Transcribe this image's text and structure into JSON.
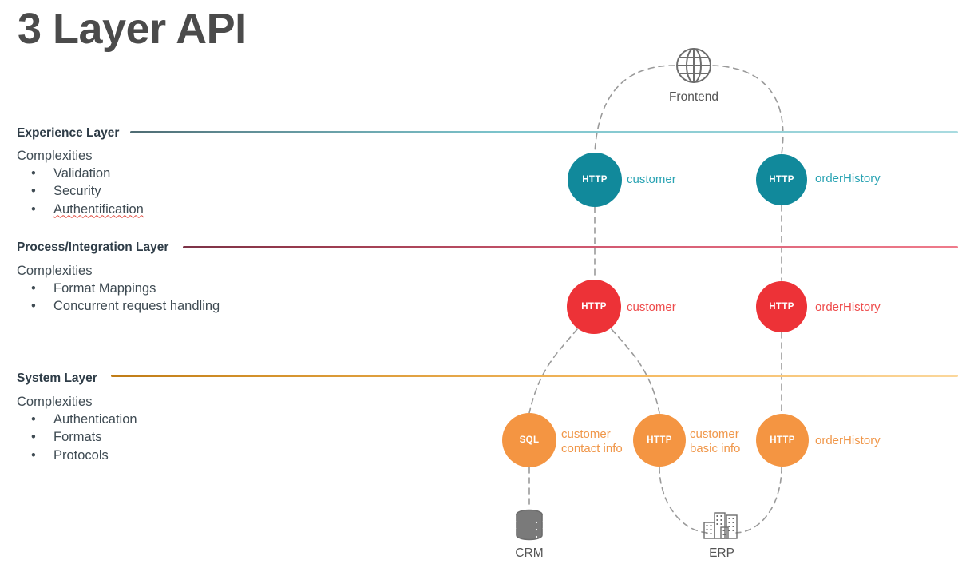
{
  "title": "3 Layer API",
  "colors": {
    "experience": "#11899b",
    "experience_label": "#29a3b3",
    "process": "#ed3237",
    "process_label": "#ee4b4b",
    "system": "#f49542",
    "system_label": "#f0974a",
    "title": "#4b4b4b",
    "text": "#3f4b53",
    "connector": "#9a9a9a",
    "spellcheck_underline": "#e0483c"
  },
  "layers": [
    {
      "name": "Experience Layer",
      "complexities_title": "Complexities",
      "bullet_char": "•",
      "bullets": [
        "Validation",
        "Security",
        "Authentification"
      ],
      "misspelled": [
        "Authentification"
      ]
    },
    {
      "name": "Process/Integration Layer",
      "complexities_title": "Complexities",
      "bullet_char": "•",
      "bullets": [
        "Format Mappings",
        "Concurrent request handling"
      ],
      "misspelled": []
    },
    {
      "name": "System Layer",
      "complexities_title": "Complexities",
      "bullet_char": "•",
      "bullets": [
        "Authentication",
        "Formats",
        "Protocols"
      ],
      "misspelled": []
    }
  ],
  "nodes": {
    "frontend": {
      "icon": "globe-icon",
      "caption": "Frontend"
    },
    "experience": [
      {
        "protocol": "HTTP",
        "label": "customer"
      },
      {
        "protocol": "HTTP",
        "label": "orderHistory"
      }
    ],
    "process": [
      {
        "protocol": "HTTP",
        "label": "customer"
      },
      {
        "protocol": "HTTP",
        "label": "orderHistory"
      }
    ],
    "system": [
      {
        "protocol": "SQL",
        "label_line1": "customer",
        "label_line2": "contact info"
      },
      {
        "protocol": "HTTP",
        "label_line1": "customer",
        "label_line2": "basic info"
      },
      {
        "protocol": "HTTP",
        "label_line1": "orderHistory",
        "label_line2": ""
      }
    ],
    "backends": [
      {
        "icon": "database-icon",
        "caption": "CRM"
      },
      {
        "icon": "buildings-icon",
        "caption": "ERP"
      }
    ]
  }
}
